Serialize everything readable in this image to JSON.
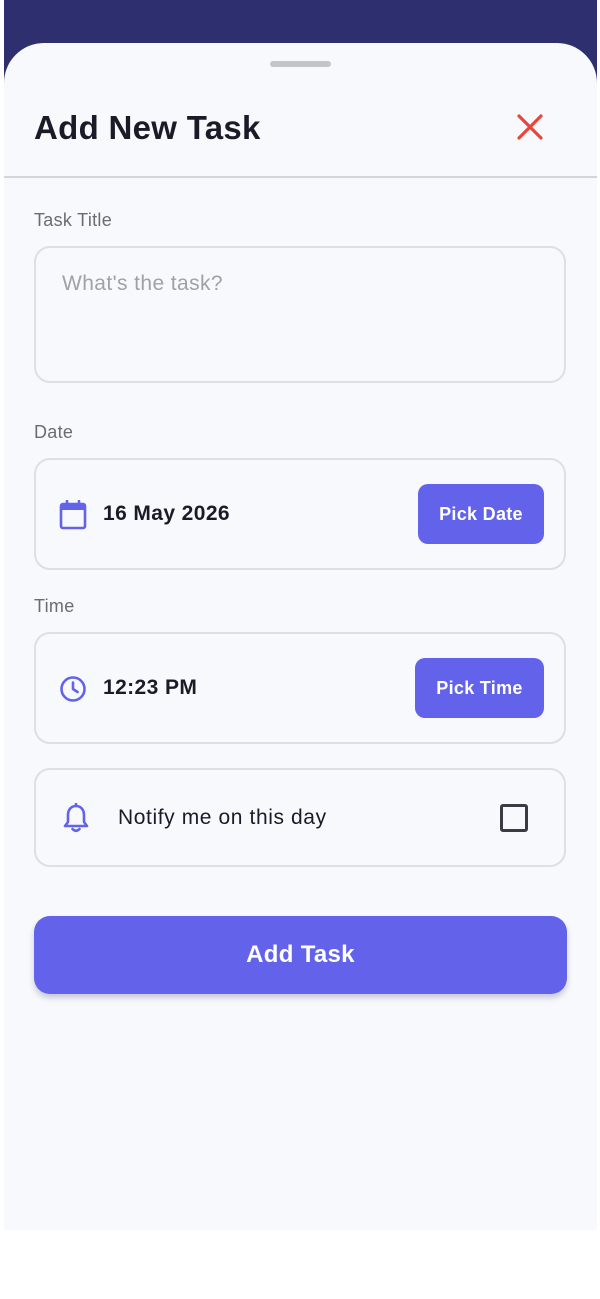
{
  "sheet": {
    "title": "Add New Task",
    "close_icon": "close-icon",
    "accent_color": "#6263ea",
    "close_color": "#e8453c"
  },
  "fields": {
    "title": {
      "label": "Task Title",
      "placeholder": "What's the task?",
      "value": ""
    },
    "date": {
      "label": "Date",
      "value": "16 May 2026",
      "icon": "calendar-icon",
      "button_label": "Pick Date"
    },
    "time": {
      "label": "Time",
      "value": "12:23 PM",
      "icon": "clock-icon",
      "button_label": "Pick Time"
    },
    "notify": {
      "label": "Notify me on this day",
      "icon": "bell-icon",
      "checked": false
    }
  },
  "actions": {
    "submit_label": "Add Task"
  }
}
